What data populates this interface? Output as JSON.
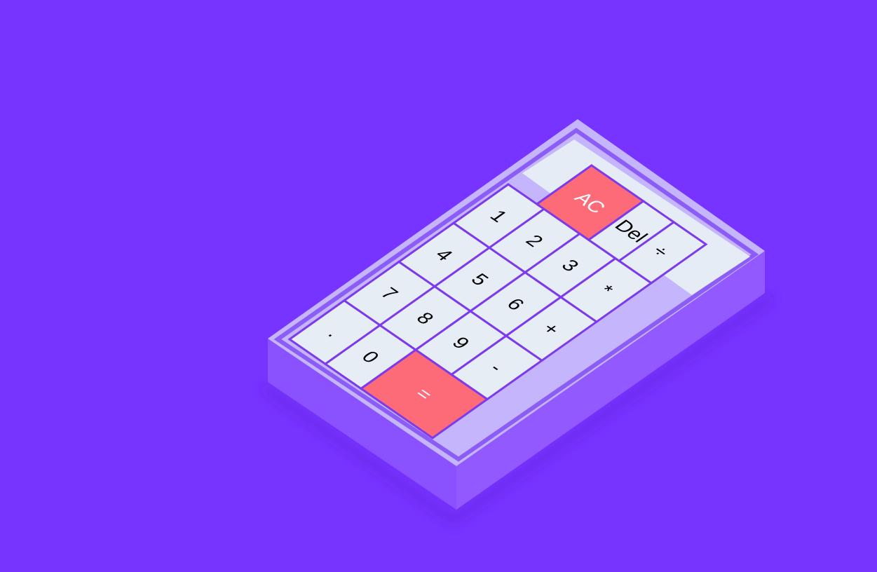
{
  "calculator": {
    "display": {
      "value": ""
    },
    "keys": [
      {
        "id": "ac",
        "label": "AC",
        "role": "clear"
      },
      {
        "id": "del",
        "label": "Del",
        "role": "delete"
      },
      {
        "id": "divide",
        "label": "÷",
        "role": "operator"
      },
      {
        "id": "1",
        "label": "1",
        "role": "digit"
      },
      {
        "id": "2",
        "label": "2",
        "role": "digit"
      },
      {
        "id": "3",
        "label": "3",
        "role": "digit"
      },
      {
        "id": "multiply",
        "label": "*",
        "role": "operator"
      },
      {
        "id": "4",
        "label": "4",
        "role": "digit"
      },
      {
        "id": "5",
        "label": "5",
        "role": "digit"
      },
      {
        "id": "6",
        "label": "6",
        "role": "digit"
      },
      {
        "id": "plus",
        "label": "+",
        "role": "operator"
      },
      {
        "id": "7",
        "label": "7",
        "role": "digit"
      },
      {
        "id": "8",
        "label": "8",
        "role": "digit"
      },
      {
        "id": "9",
        "label": "9",
        "role": "digit"
      },
      {
        "id": "minus",
        "label": "-",
        "role": "operator"
      },
      {
        "id": "decimal",
        "label": ".",
        "role": "decimal"
      },
      {
        "id": "0",
        "label": "0",
        "role": "digit"
      },
      {
        "id": "equals",
        "label": "=",
        "role": "equals"
      }
    ]
  },
  "colors": {
    "background": "#7733ff",
    "body_top": "#c4b5fd",
    "body_side_left": "#8a52ff",
    "body_side_right": "#9259ff",
    "key_face": "#e7edf5",
    "key_border": "#7c3aed",
    "accent_key": "#fd6a78",
    "display": "#e5ecf5",
    "key_text": "#000000",
    "accent_text": "#ffffff"
  }
}
